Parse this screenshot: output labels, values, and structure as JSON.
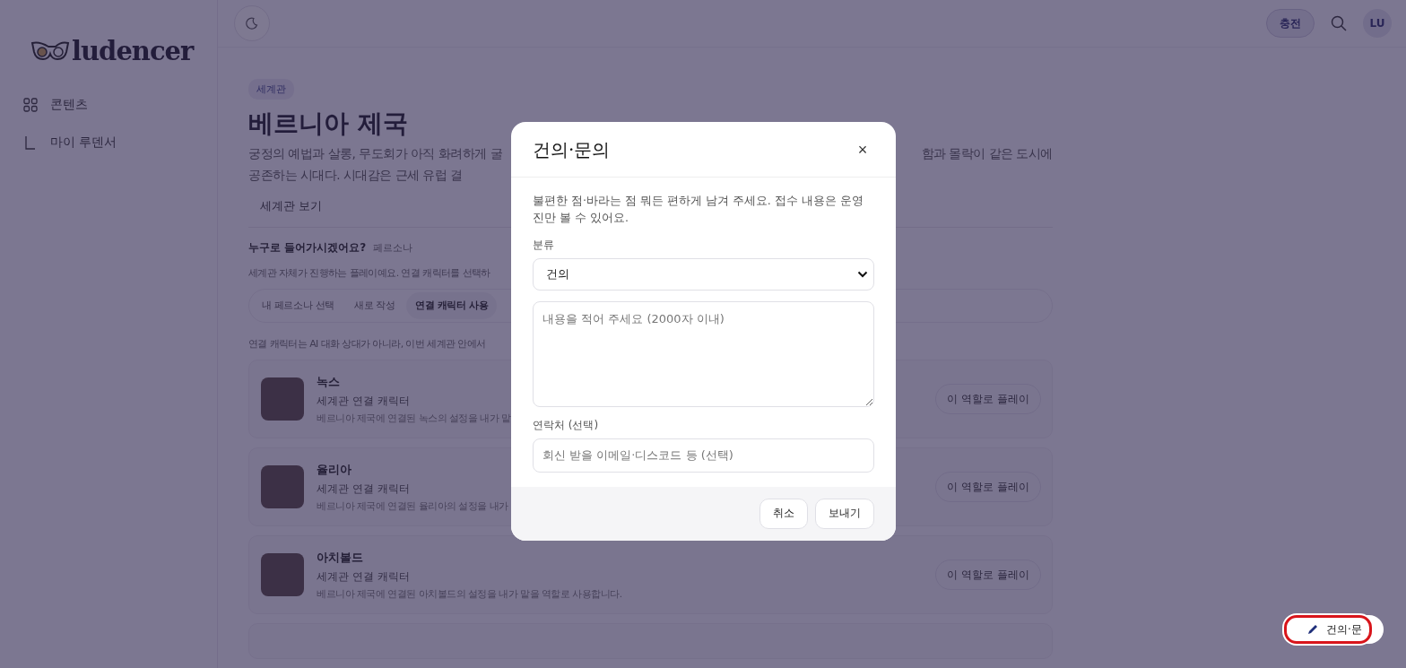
{
  "sidebar": {
    "logo": "ludencer",
    "items": [
      {
        "kind": "grid",
        "label": "콘텐츠"
      },
      {
        "kind": "corner",
        "label": "마이 루덴서"
      }
    ]
  },
  "topbar": {
    "charge_button": "충전",
    "avatar": "LU"
  },
  "world": {
    "badge": "세계관",
    "title": "베르니아 제국",
    "description_1": "궁정의 예법과 살롱, 무도회가 아직 화려하게 굴",
    "description_2": "함과 몰락이 같은 도시에",
    "description_3": "공존하는 시대다. 시대감은 근세 유럽 결",
    "view_link": "세계관 보기"
  },
  "persona": {
    "question": "누구로 들어가시겠어요?",
    "tag": "페르소나",
    "note": "세계관 자체가 진행하는 플레이예요. 연결 캐릭터를 선택하",
    "tabs": [
      {
        "label": "내 페르소나 선택",
        "selected": false
      },
      {
        "label": "새로 작성",
        "selected": false
      },
      {
        "label": "연결 캐릭터 사용",
        "selected": true
      }
    ],
    "explain": "연결 캐릭터는 AI 대화 상대가 아니라, 이번 세계관 안에서"
  },
  "characters": [
    {
      "name": "녹스",
      "role": "세계관 연결 캐릭터",
      "description": "베르니아 제국에 연결된 녹스의 설정을 내가 맡",
      "button": "이 역할로 플레이"
    },
    {
      "name": "율리아",
      "role": "세계관 연결 캐릭터",
      "description": "베르니아 제국에 연결된 율리아의 설정을 내가",
      "button": "이 역할로 플레이"
    },
    {
      "name": "아치볼드",
      "role": "세계관 연결 캐릭터",
      "description": "베르니아 제국에 연결된 아치볼드의 설정을 내가 맡을 역할로 사용합니다.",
      "button": "이 역할로 플레이"
    }
  ],
  "dialog": {
    "title": "건의·문의",
    "close": "×",
    "intro": "불편한 점·바라는 점 뭐든 편하게 남겨 주세요. 접수 내용은 운영진만 볼 수 있어요.",
    "category_label": "분류",
    "category_value": "건의",
    "message_placeholder": "내용을 적어 주세요 (2000자 이내)",
    "contact_label": "연락처 (선택)",
    "contact_placeholder": "회신 받을 이메일·디스코드 등 (선택)",
    "cancel": "취소",
    "send": "보내기"
  },
  "feedback_button": {
    "label": "건의·문",
    "highlighted": true
  }
}
